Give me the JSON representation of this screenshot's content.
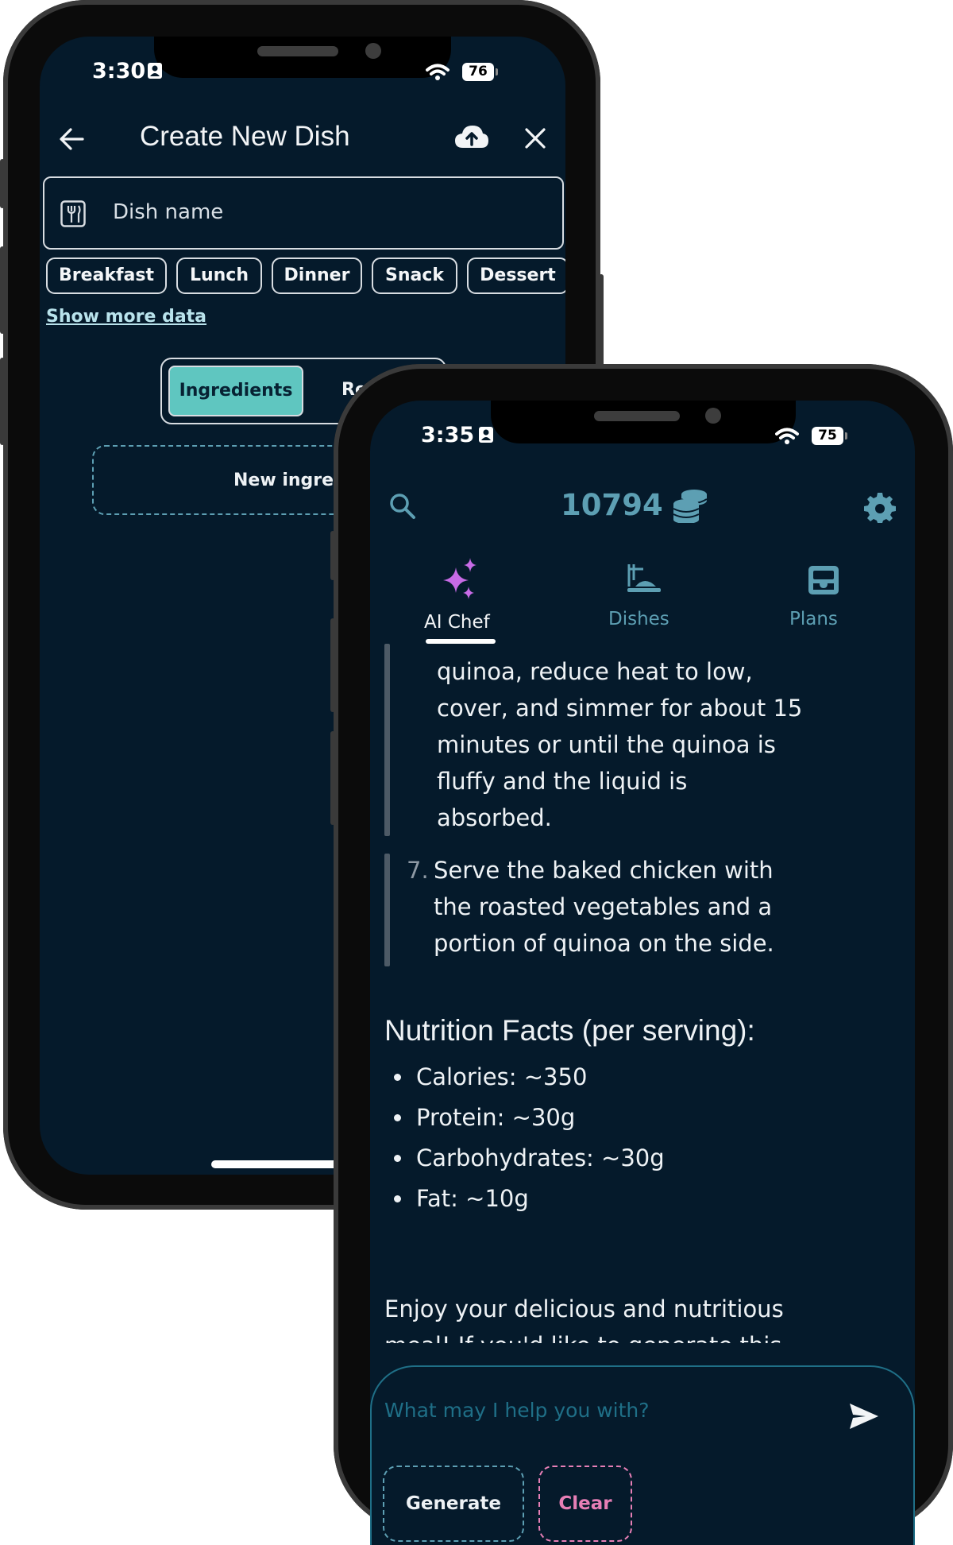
{
  "phone1": {
    "status": {
      "time": "3:30",
      "battery": "76"
    },
    "header": {
      "title": "Create New Dish"
    },
    "dish_field": {
      "placeholder": "Dish name"
    },
    "chips": [
      "Breakfast",
      "Lunch",
      "Dinner",
      "Snack",
      "Dessert"
    ],
    "show_more": "Show more data",
    "segments": {
      "ingredients": "Ingredients",
      "recipe": "Re"
    },
    "new_ingredient": "New ingred"
  },
  "phone2": {
    "status": {
      "time": "3:35",
      "battery": "75"
    },
    "coins": "10794",
    "tabs": [
      {
        "label": "AI Chef",
        "icon": "sparkles-icon",
        "active": true
      },
      {
        "label": "Dishes",
        "icon": "dish-icon",
        "active": false
      },
      {
        "label": "Plans",
        "icon": "inbox-tray-icon",
        "active": false
      }
    ],
    "step6_lines": [
      "quinoa, reduce heat to low,",
      "cover, and simmer for about 15",
      "minutes or until the quinoa is",
      "fluffy and the liquid is",
      "absorbed."
    ],
    "step7": {
      "number": "7.",
      "lines": [
        "Serve the baked chicken with",
        "the roasted vegetables and a",
        "portion of quinoa on the side."
      ]
    },
    "nutrition": {
      "heading": "Nutrition Facts (per serving):",
      "items": [
        "Calories: ~350",
        "Protein: ~30g",
        "Carbohydrates: ~30g",
        "Fat: ~10g"
      ]
    },
    "closing_lines": [
      "Enjoy your delicious and nutritious",
      "meal! If you'd like to generate this"
    ],
    "composer": {
      "placeholder": "What may I help you with?",
      "generate": "Generate",
      "clear": "Clear"
    },
    "colors": {
      "accent": "#5d9fb3",
      "sparkle": "#c86be6",
      "clear": "#e77fb6",
      "active_segment": "#5fc6c0"
    }
  }
}
